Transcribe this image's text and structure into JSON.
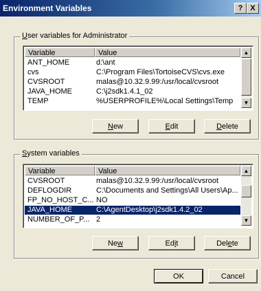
{
  "window": {
    "title": "Environment Variables",
    "help_label": "?",
    "close_label": "X"
  },
  "user_group": {
    "legend_u": "U",
    "legend_rest": "ser variables for Administrator",
    "headers": [
      "Variable",
      "Value"
    ],
    "rows": [
      {
        "variable": "ANT_HOME",
        "value": "d:\\ant"
      },
      {
        "variable": "cvs",
        "value": "C:\\Program Files\\TortoiseCVS\\cvs.exe"
      },
      {
        "variable": "CVSROOT",
        "value": "malas@10.32.9.99:/usr/local/cvsroot"
      },
      {
        "variable": "JAVA_HOME",
        "value": "C:\\j2sdk1.4.1_02"
      },
      {
        "variable": "TEMP",
        "value": "%USERPROFILE%\\Local Settings\\Temp"
      }
    ],
    "buttons": {
      "new_pre": "",
      "new_u": "N",
      "new_post": "ew",
      "edit_pre": "",
      "edit_u": "E",
      "edit_post": "dit",
      "delete_pre": "",
      "delete_u": "D",
      "delete_post": "elete"
    }
  },
  "system_group": {
    "legend_u": "S",
    "legend_rest": "ystem variables",
    "headers": [
      "Variable",
      "Value"
    ],
    "rows": [
      {
        "variable": "CVSROOT",
        "value": "malas@10.32.9.99:/usr/local/cvsroot"
      },
      {
        "variable": "DEFLOGDIR",
        "value": "C:\\Documents and Settings\\All Users\\Ap..."
      },
      {
        "variable": "FP_NO_HOST_C...",
        "value": "NO"
      },
      {
        "variable": "JAVA_HOME",
        "value": "C:\\AgentDesktop\\j2sdk1.4.2_02",
        "selected": true
      },
      {
        "variable": "NUMBER_OF_P...",
        "value": "2"
      }
    ],
    "buttons": {
      "new_pre": "Ne",
      "new_u": "w",
      "new_post": "",
      "edit_pre": "Ed",
      "edit_u": "i",
      "edit_post": "t",
      "delete_pre": "Del",
      "delete_u": "e",
      "delete_post": "te"
    }
  },
  "footer": {
    "ok_label": "OK",
    "cancel_label": "Cancel"
  }
}
